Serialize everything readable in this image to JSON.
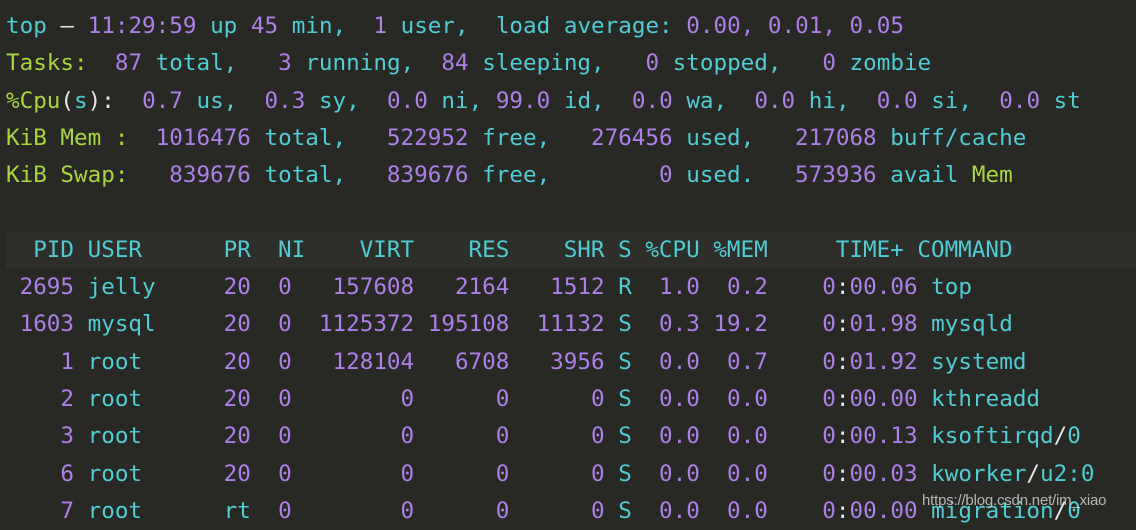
{
  "terminal": {
    "background_color": "#282824",
    "colors": {
      "label_green": "#a8d73a",
      "text_cyan": "#4ecdd4",
      "number_purple": "#ad7fe8",
      "punctuation_white": "#e6e6e6"
    }
  },
  "summary": {
    "uptime_line": {
      "program": "top",
      "dash": "—",
      "time": "11:29:59",
      "up_word": "up",
      "up_value": "45",
      "up_unit": "min,",
      "users_count": "1",
      "users_word": "user,",
      "load_label": "load average:",
      "load_1": "0.00,",
      "load_5": "0.01,",
      "load_15": "0.05"
    },
    "tasks_line": {
      "label": "Tasks:",
      "total_value": "87",
      "total_word": "total,",
      "running_value": "3",
      "running_word": "running,",
      "sleeping_value": "84",
      "sleeping_word": "sleeping,",
      "stopped_value": "0",
      "stopped_word": "stopped,",
      "zombie_value": "0",
      "zombie_word": "zombie"
    },
    "cpu_line": {
      "label_pct_cpu": "%Cpu",
      "paren_open": "(",
      "label_s": "s",
      "paren_close": "):",
      "us_value": "0.7",
      "us_word": "us,",
      "sy_value": "0.3",
      "sy_word": "sy,",
      "ni_value": "0.0",
      "ni_word": "ni,",
      "id_value": "99.0",
      "id_word": "id,",
      "wa_value": "0.0",
      "wa_word": "wa,",
      "hi_value": "0.0",
      "hi_word": "hi,",
      "si_value": "0.0",
      "si_word": "si,",
      "st_value": "0.0",
      "st_word": "st"
    },
    "mem_line": {
      "label": "KiB Mem :",
      "total_value": "1016476",
      "total_word": "total,",
      "free_value": "522952",
      "free_word": "free,",
      "used_value": "276456",
      "used_word": "used,",
      "buff_value": "217068",
      "buff_word": "buff/cache"
    },
    "swap_line": {
      "label": "KiB Swap:",
      "total_value": "839676",
      "total_word": "total,",
      "free_value": "839676",
      "free_word": "free,",
      "used_value": "0",
      "used_word": "used.",
      "avail_value": "573936",
      "avail_word": "avail",
      "avail_mem": "Mem"
    }
  },
  "process_table": {
    "headers": {
      "pid": "PID",
      "user": "USER",
      "pr": "PR",
      "ni": "NI",
      "virt": "VIRT",
      "res": "RES",
      "shr": "SHR",
      "s": "S",
      "cpu": "%CPU",
      "mem": "%MEM",
      "time": "TIME+",
      "command": "COMMAND"
    },
    "header_line": "  PID USER      PR  NI    VIRT    RES    SHR S %CPU %MEM     TIME+ COMMAND",
    "rows": [
      {
        "pid": "2695",
        "user": "jelly",
        "pr": "20",
        "ni": "0",
        "virt": "157608",
        "res": "2164",
        "shr": "1512",
        "s": "R",
        "cpu": "1.0",
        "mem": "0.2",
        "time": "0:00.06",
        "command": "top"
      },
      {
        "pid": "1603",
        "user": "mysql",
        "pr": "20",
        "ni": "0",
        "virt": "1125372",
        "res": "195108",
        "shr": "11132",
        "s": "S",
        "cpu": "0.3",
        "mem": "19.2",
        "time": "0:01.98",
        "command": "mysqld"
      },
      {
        "pid": "1",
        "user": "root",
        "pr": "20",
        "ni": "0",
        "virt": "128104",
        "res": "6708",
        "shr": "3956",
        "s": "S",
        "cpu": "0.0",
        "mem": "0.7",
        "time": "0:01.92",
        "command": "systemd"
      },
      {
        "pid": "2",
        "user": "root",
        "pr": "20",
        "ni": "0",
        "virt": "0",
        "res": "0",
        "shr": "0",
        "s": "S",
        "cpu": "0.0",
        "mem": "0.0",
        "time": "0:00.00",
        "command": "kthreadd"
      },
      {
        "pid": "3",
        "user": "root",
        "pr": "20",
        "ni": "0",
        "virt": "0",
        "res": "0",
        "shr": "0",
        "s": "S",
        "cpu": "0.0",
        "mem": "0.0",
        "time": "0:00.13",
        "command": "ksoftirqd/0"
      },
      {
        "pid": "6",
        "user": "root",
        "pr": "20",
        "ni": "0",
        "virt": "0",
        "res": "0",
        "shr": "0",
        "s": "S",
        "cpu": "0.0",
        "mem": "0.0",
        "time": "0:00.03",
        "command": "kworker/u2:0"
      },
      {
        "pid": "7",
        "user": "root",
        "pr": "rt",
        "ni": "0",
        "virt": "0",
        "res": "0",
        "shr": "0",
        "s": "S",
        "cpu": "0.0",
        "mem": "0.0",
        "time": "0:00.00",
        "command": "migration/0"
      }
    ]
  },
  "watermark": {
    "text": "https://blog.csdn.net/im_xiao"
  }
}
